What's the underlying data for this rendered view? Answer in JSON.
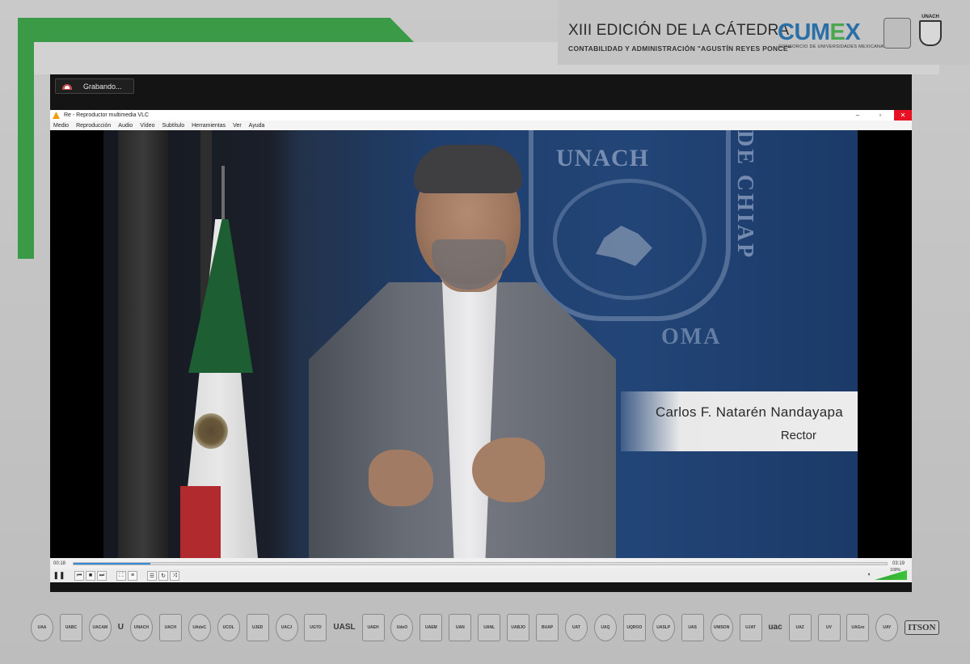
{
  "header": {
    "catedra_title": "XIII EDICIÓN DE LA CÁTEDRA",
    "catedra_subtitle": "CONTABILIDAD Y ADMINISTRACIÓN \"AGUSTÍN REYES PONCE\"",
    "cumex_logo_left": "CUM",
    "cumex_logo_x": "E",
    "cumex_logo_right": "X",
    "cumex_sub": "CONSORCIO DE UNIVERSIDADES MEXICANAS",
    "unach_label": "UNACH"
  },
  "recording": {
    "label": "Grabando..."
  },
  "vlc": {
    "window_title": "Re - Reproductor multimedia VLC",
    "menu": [
      "Medio",
      "Reproducción",
      "Audio",
      "Vídeo",
      "Subtítulo",
      "Herramientas",
      "Ver",
      "Ayuda"
    ],
    "window_controls": {
      "minimize": "–",
      "maximize": "▫",
      "close": "✕"
    },
    "time_elapsed": "00:18",
    "time_total": "03:19",
    "progress_fraction": 0.094,
    "volume_label": "100%"
  },
  "video": {
    "emblem_text": "UNACH",
    "vertical_text": "DE CHIAP",
    "partial_text": "OMA",
    "speaker_name": "Carlos F. Natarén Nandayapa",
    "speaker_role": "Rector"
  },
  "university_logos": [
    {
      "kind": "round",
      "text": "UAA"
    },
    {
      "kind": "shield",
      "text": "UABC"
    },
    {
      "kind": "round",
      "text": "UACAM"
    },
    {
      "kind": "text",
      "text": "U"
    },
    {
      "kind": "round",
      "text": "UNACH"
    },
    {
      "kind": "shield",
      "text": "UACH"
    },
    {
      "kind": "round",
      "text": "UAdeC"
    },
    {
      "kind": "round",
      "text": "UCOL"
    },
    {
      "kind": "shield",
      "text": "UJED"
    },
    {
      "kind": "round",
      "text": "UACJ"
    },
    {
      "kind": "shield",
      "text": "UGTO"
    },
    {
      "kind": "text",
      "text": "UASL"
    },
    {
      "kind": "shield",
      "text": "UAEH"
    },
    {
      "kind": "round",
      "text": "UdeO"
    },
    {
      "kind": "shield",
      "text": "UAEM"
    },
    {
      "kind": "shield",
      "text": "UAN"
    },
    {
      "kind": "shield",
      "text": "UANL"
    },
    {
      "kind": "shield",
      "text": "UABJO"
    },
    {
      "kind": "shield",
      "text": "BUAP"
    },
    {
      "kind": "round",
      "text": "UAT"
    },
    {
      "kind": "round",
      "text": "UAQ"
    },
    {
      "kind": "shield",
      "text": "UQROO"
    },
    {
      "kind": "round",
      "text": "UASLP"
    },
    {
      "kind": "shield",
      "text": "UAS"
    },
    {
      "kind": "round",
      "text": "UNISON"
    },
    {
      "kind": "shield",
      "text": "UJAT"
    },
    {
      "kind": "text",
      "text": "uac"
    },
    {
      "kind": "shield",
      "text": "UAZ"
    },
    {
      "kind": "shield",
      "text": "UV"
    },
    {
      "kind": "shield",
      "text": "UAGro"
    },
    {
      "kind": "round",
      "text": "UAY"
    },
    {
      "kind": "itson",
      "text": "ITSON"
    }
  ]
}
